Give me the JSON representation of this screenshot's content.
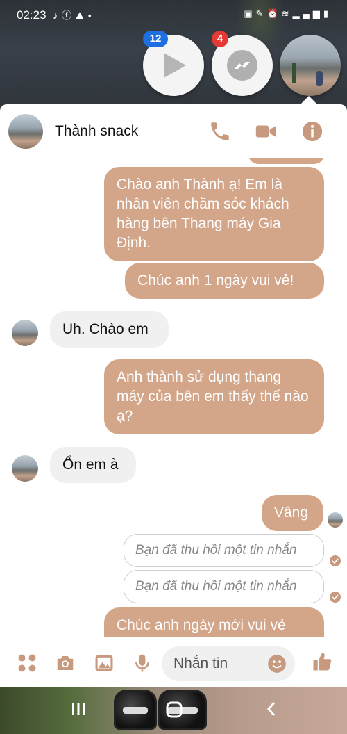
{
  "status_bar": {
    "time": "02:23",
    "left_icons": [
      "tiktok-icon",
      "facebook-icon",
      "mountain-icon",
      "dot-icon"
    ],
    "right_icons": [
      "battery-saver-icon",
      "no-pen-icon",
      "alarm-icon",
      "wifi-icon",
      "signal-icon",
      "battery-icon"
    ]
  },
  "chat_heads": {
    "play_badge": "12",
    "messenger_badge": "4"
  },
  "chat": {
    "contact_name": "Thành snack",
    "messages": [
      {
        "dir": "out",
        "text": "Chào anh Thành ạ! Em là nhân viên chăm sóc khách hàng bên Thang máy Gia Định."
      },
      {
        "dir": "out",
        "text": "Chúc anh 1 ngày vui vẻ!"
      },
      {
        "dir": "in",
        "text": "Uh. Chào em"
      },
      {
        "dir": "out",
        "text": "Anh thành sử dụng thang máy của bên em thấy thế nào ạ?"
      },
      {
        "dir": "in",
        "text": "Ổn em à"
      },
      {
        "dir": "out",
        "text": "Vâng"
      },
      {
        "dir": "recalled",
        "text": "Bạn đã thu hồi một tin nhắn"
      },
      {
        "dir": "recalled",
        "text": "Bạn đã thu hồi một tin nhắn"
      },
      {
        "dir": "out",
        "text": "Chúc anh ngày mới vui vẻ"
      }
    ]
  },
  "composer": {
    "placeholder": "Nhắn tin"
  },
  "colors": {
    "accent": "#c79a80",
    "outgoing_bubble": "#d3a589",
    "incoming_bubble": "#f0f0f0"
  }
}
